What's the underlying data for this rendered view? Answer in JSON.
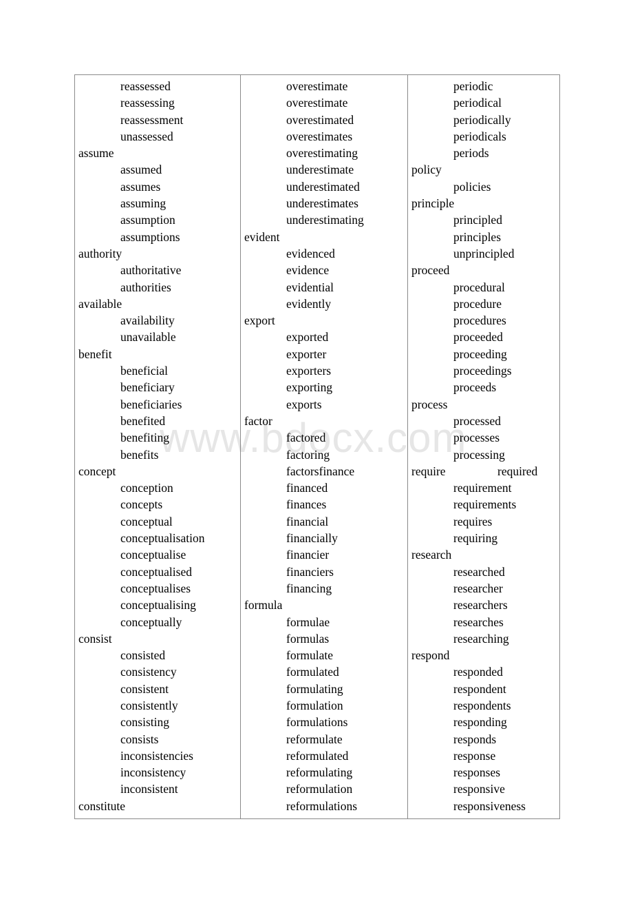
{
  "document": {
    "type": "academic-word-list-table",
    "watermark": "www.bdocx.com",
    "columns": [
      {
        "id": "column-1",
        "entries": [
          {
            "word": "reassessed",
            "indent": 1
          },
          {
            "word": "reassessing",
            "indent": 1
          },
          {
            "word": "reassessment",
            "indent": 1
          },
          {
            "word": "unassessed",
            "indent": 1
          },
          {
            "word": "assume",
            "indent": 0
          },
          {
            "word": "assumed",
            "indent": 1
          },
          {
            "word": "assumes",
            "indent": 1
          },
          {
            "word": "assuming",
            "indent": 1
          },
          {
            "word": "assumption",
            "indent": 1
          },
          {
            "word": "assumptions",
            "indent": 1
          },
          {
            "word": "authority",
            "indent": 0
          },
          {
            "word": "authoritative",
            "indent": 1
          },
          {
            "word": "authorities",
            "indent": 1
          },
          {
            "word": "available",
            "indent": 0
          },
          {
            "word": "availability",
            "indent": 1
          },
          {
            "word": "unavailable",
            "indent": 1
          },
          {
            "word": "benefit",
            "indent": 0
          },
          {
            "word": "beneficial",
            "indent": 1
          },
          {
            "word": "beneficiary",
            "indent": 1
          },
          {
            "word": "beneficiaries",
            "indent": 1
          },
          {
            "word": "benefited",
            "indent": 1
          },
          {
            "word": "benefiting",
            "indent": 1
          },
          {
            "word": "benefits",
            "indent": 1
          },
          {
            "word": "concept",
            "indent": 0
          },
          {
            "word": "conception",
            "indent": 1
          },
          {
            "word": "concepts",
            "indent": 1
          },
          {
            "word": "conceptual",
            "indent": 1
          },
          {
            "word": "conceptualisation",
            "indent": 1
          },
          {
            "word": "conceptualise",
            "indent": 1
          },
          {
            "word": "conceptualised",
            "indent": 1
          },
          {
            "word": "conceptualises",
            "indent": 1
          },
          {
            "word": "conceptualising",
            "indent": 1
          },
          {
            "word": "conceptually",
            "indent": 1
          },
          {
            "word": "consist",
            "indent": 0
          },
          {
            "word": "consisted",
            "indent": 1
          },
          {
            "word": "consistency",
            "indent": 1
          },
          {
            "word": "consistent",
            "indent": 1
          },
          {
            "word": "consistently",
            "indent": 1
          },
          {
            "word": "consisting",
            "indent": 1
          },
          {
            "word": "consists",
            "indent": 1
          },
          {
            "word": "inconsistencies",
            "indent": 1
          },
          {
            "word": "inconsistency",
            "indent": 1
          },
          {
            "word": "inconsistent",
            "indent": 1
          },
          {
            "word": "constitute",
            "indent": 0
          }
        ]
      },
      {
        "id": "column-2",
        "entries": [
          {
            "word": "overestimate",
            "indent": 1
          },
          {
            "word": "overestimate",
            "indent": 1
          },
          {
            "word": "overestimated",
            "indent": 1
          },
          {
            "word": "overestimates",
            "indent": 1
          },
          {
            "word": "overestimating",
            "indent": 1
          },
          {
            "word": "underestimate",
            "indent": 1
          },
          {
            "word": "underestimated",
            "indent": 1
          },
          {
            "word": "underestimates",
            "indent": 1
          },
          {
            "word": "underestimating",
            "indent": 1
          },
          {
            "word": "evident",
            "indent": 0
          },
          {
            "word": "evidenced",
            "indent": 1
          },
          {
            "word": "evidence",
            "indent": 1
          },
          {
            "word": "evidential",
            "indent": 1
          },
          {
            "word": "evidently",
            "indent": 1
          },
          {
            "word": "export",
            "indent": 0
          },
          {
            "word": "exported",
            "indent": 1
          },
          {
            "word": "exporter",
            "indent": 1
          },
          {
            "word": "exporters",
            "indent": 1
          },
          {
            "word": "exporting",
            "indent": 1
          },
          {
            "word": "exports",
            "indent": 1
          },
          {
            "word": "factor",
            "indent": 0
          },
          {
            "word": "factored",
            "indent": 1
          },
          {
            "word": "factoring",
            "indent": 1
          },
          {
            "word": "factorsfinance",
            "indent": 1
          },
          {
            "word": "financed",
            "indent": 1
          },
          {
            "word": "finances",
            "indent": 1
          },
          {
            "word": "financial",
            "indent": 1
          },
          {
            "word": "financially",
            "indent": 1
          },
          {
            "word": "financier",
            "indent": 1
          },
          {
            "word": "financiers",
            "indent": 1
          },
          {
            "word": "financing",
            "indent": 1
          },
          {
            "word": "formula",
            "indent": 0
          },
          {
            "word": "formulae",
            "indent": 1
          },
          {
            "word": "formulas",
            "indent": 1
          },
          {
            "word": "formulate",
            "indent": 1
          },
          {
            "word": "formulated",
            "indent": 1
          },
          {
            "word": "formulating",
            "indent": 1
          },
          {
            "word": "formulation",
            "indent": 1
          },
          {
            "word": "formulations",
            "indent": 1
          },
          {
            "word": "reformulate",
            "indent": 1
          },
          {
            "word": "reformulated",
            "indent": 1
          },
          {
            "word": "reformulating",
            "indent": 1
          },
          {
            "word": "reformulation",
            "indent": 1
          },
          {
            "word": "reformulations",
            "indent": 1
          }
        ]
      },
      {
        "id": "column-3",
        "entries": [
          {
            "word": "periodic",
            "indent": 1
          },
          {
            "word": "periodical",
            "indent": 1
          },
          {
            "word": "periodically",
            "indent": 1
          },
          {
            "word": "periodicals",
            "indent": 1
          },
          {
            "word": "periods",
            "indent": 1
          },
          {
            "word": "policy",
            "indent": 0
          },
          {
            "word": "policies",
            "indent": 1
          },
          {
            "word": "principle",
            "indent": 0
          },
          {
            "word": "principled",
            "indent": 1
          },
          {
            "word": "principles",
            "indent": 1
          },
          {
            "word": "unprincipled",
            "indent": 1
          },
          {
            "word": "proceed",
            "indent": 0
          },
          {
            "word": "procedural",
            "indent": 1
          },
          {
            "word": "procedure",
            "indent": 1
          },
          {
            "word": "procedures",
            "indent": 1
          },
          {
            "word": "proceeded",
            "indent": 1
          },
          {
            "word": "proceeding",
            "indent": 1
          },
          {
            "word": "proceedings",
            "indent": 1
          },
          {
            "word": "proceeds",
            "indent": 1
          },
          {
            "word": "process",
            "indent": 0
          },
          {
            "word": "processed",
            "indent": 1
          },
          {
            "word": "processes",
            "indent": 1
          },
          {
            "word": "processing",
            "indent": 1
          },
          {
            "word": "require",
            "indent": 0,
            "word2": "required"
          },
          {
            "word": "requirement",
            "indent": 1
          },
          {
            "word": "requirements",
            "indent": 1
          },
          {
            "word": "requires",
            "indent": 1
          },
          {
            "word": "requiring",
            "indent": 1
          },
          {
            "word": "research",
            "indent": 0
          },
          {
            "word": "researched",
            "indent": 1
          },
          {
            "word": "researcher",
            "indent": 1
          },
          {
            "word": "researchers",
            "indent": 1
          },
          {
            "word": "researches",
            "indent": 1
          },
          {
            "word": "researching",
            "indent": 1
          },
          {
            "word": "respond",
            "indent": 0
          },
          {
            "word": "responded",
            "indent": 1
          },
          {
            "word": "respondent",
            "indent": 1
          },
          {
            "word": "respondents",
            "indent": 1
          },
          {
            "word": "responding",
            "indent": 1
          },
          {
            "word": "responds",
            "indent": 1
          },
          {
            "word": "response",
            "indent": 1
          },
          {
            "word": "responses",
            "indent": 1
          },
          {
            "word": "responsive",
            "indent": 1
          },
          {
            "word": "responsiveness",
            "indent": 1
          }
        ]
      }
    ]
  }
}
